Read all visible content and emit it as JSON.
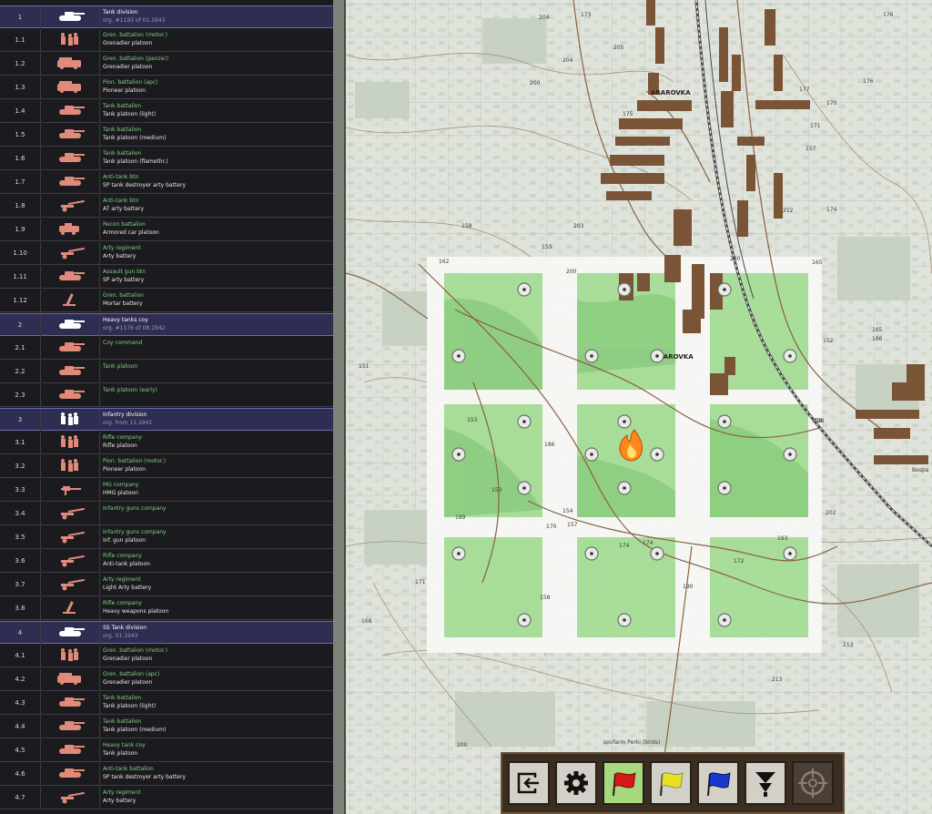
{
  "oob": {
    "rows": [
      {
        "num": "1",
        "l1": "Tank division",
        "l2": "org. #1193 of 01.1943",
        "hq": true,
        "icon": "tank-icon"
      },
      {
        "num": "1.1",
        "l1": "Gren. battalion (motor.)",
        "l2": "Grenadier platoon",
        "icon": "infantry-icon"
      },
      {
        "num": "1.2",
        "l1": "Gren. battalion (panzer)",
        "l2": "Grenadier platoon",
        "icon": "halftrack-icon"
      },
      {
        "num": "1.3",
        "l1": "Pion. battalion (apc)",
        "l2": "Pioneer platoon",
        "icon": "halftrack-icon"
      },
      {
        "num": "1.4",
        "l1": "Tank battalion",
        "l2": "Tank platoon (light)",
        "icon": "tank-icon"
      },
      {
        "num": "1.5",
        "l1": "Tank battalion",
        "l2": "Tank platoon (medium)",
        "icon": "tank-icon"
      },
      {
        "num": "1.6",
        "l1": "Tank battalion",
        "l2": "Tank platoon (flamethr.)",
        "icon": "tank-icon"
      },
      {
        "num": "1.7",
        "l1": "Anti-tank btn",
        "l2": "SP tank destroyer arty battery",
        "icon": "tank-icon"
      },
      {
        "num": "1.8",
        "l1": "Anti-tank btn",
        "l2": "AT arty battery",
        "icon": "gun-icon"
      },
      {
        "num": "1.9",
        "l1": "Recon battalion",
        "l2": "Armored car platoon",
        "icon": "armored-car-icon"
      },
      {
        "num": "1.10",
        "l1": "Arty regiment",
        "l2": "Arty battery",
        "icon": "gun-icon"
      },
      {
        "num": "1.11",
        "l1": "Assault gun btn",
        "l2": "SP arty battery",
        "icon": "tank-icon"
      },
      {
        "num": "1.12",
        "l1": "Gren. battalion",
        "l2": "Mortar battery",
        "icon": "mortar-icon"
      },
      {
        "num": "2",
        "l1": "Heavy tanks coy",
        "l2": "org. #1176 of 08.1942",
        "hq": true,
        "icon": "tank-icon"
      },
      {
        "num": "2.1",
        "l1": "Coy command",
        "l2": "",
        "icon": "tank-icon"
      },
      {
        "num": "2.2",
        "l1": "Tank platoon",
        "l2": "",
        "icon": "tank-icon"
      },
      {
        "num": "2.3",
        "l1": "Tank platoon (early)",
        "l2": "",
        "icon": "tank-icon"
      },
      {
        "num": "3",
        "l1": "Infantry division",
        "l2": "org. from 11.1941",
        "hq": true,
        "icon": "infantry-icon"
      },
      {
        "num": "3.1",
        "l1": "Rifle company",
        "l2": "Rifle platoon",
        "icon": "infantry-icon"
      },
      {
        "num": "3.2",
        "l1": "Pion. battalion (motor.)",
        "l2": "Pioneer platoon",
        "icon": "infantry-icon"
      },
      {
        "num": "3.3",
        "l1": "MG company",
        "l2": "HMG platoon",
        "icon": "mg-icon"
      },
      {
        "num": "3.4",
        "l1": "Infantry guns company",
        "l2": "",
        "icon": "gun-icon"
      },
      {
        "num": "3.5",
        "l1": "Infantry guns company",
        "l2": "Inf. gun platoon",
        "icon": "gun-icon"
      },
      {
        "num": "3.6",
        "l1": "Rifle company",
        "l2": "Anti-tank platoon",
        "icon": "gun-icon"
      },
      {
        "num": "3.7",
        "l1": "Arty regiment",
        "l2": "Light Arty battery",
        "icon": "gun-icon"
      },
      {
        "num": "3.8",
        "l1": "Rifle company",
        "l2": "Heavy weapons platoon",
        "icon": "mortar-icon"
      },
      {
        "num": "4",
        "l1": "SS Tank division",
        "l2": "org. 01.1943",
        "hq": true,
        "icon": "tank-icon"
      },
      {
        "num": "4.1",
        "l1": "Gren. battalion (motor.)",
        "l2": "Grenadier platoon",
        "icon": "infantry-icon"
      },
      {
        "num": "4.2",
        "l1": "Gren. battalion (apc)",
        "l2": "Grenadier platoon",
        "icon": "halftrack-icon"
      },
      {
        "num": "4.3",
        "l1": "Tank battalion",
        "l2": "Tank platoon (light)",
        "icon": "tank-icon"
      },
      {
        "num": "4.4",
        "l1": "Tank battalion",
        "l2": "Tank platoon (medium)",
        "icon": "tank-icon"
      },
      {
        "num": "4.5",
        "l1": "Heavy tank coy",
        "l2": "Tank platoon",
        "icon": "tank-icon"
      },
      {
        "num": "4.6",
        "l1": "Anti-tank battalion",
        "l2": "SP tank destroyer arty battery",
        "icon": "tank-icon"
      },
      {
        "num": "4.7",
        "l1": "Arty regiment",
        "l2": "Arty battery",
        "icon": "gun-icon"
      }
    ]
  },
  "map": {
    "town_labels": [
      "ARAROVKA",
      "ARAROVKA",
      "Bespa"
    ],
    "farm_label": "sovfarm Perki (birds)",
    "elevations": [
      "173",
      "176",
      "204",
      "200",
      "175",
      "170",
      "177",
      "176",
      "205",
      "171",
      "157",
      "159",
      "153",
      "203",
      "200",
      "162",
      "200",
      "212",
      "174",
      "151",
      "165",
      "166",
      "158",
      "153",
      "186",
      "153",
      "154",
      "170",
      "157",
      "189",
      "174",
      "174",
      "172",
      "190",
      "193",
      "171",
      "158",
      "200",
      "213",
      "213",
      "198",
      "202",
      "204",
      "168",
      "152",
      "165"
    ]
  },
  "toolbar": {
    "buttons": [
      {
        "name": "exit-button",
        "icon": "exit-icon"
      },
      {
        "name": "settings-button",
        "icon": "gear-icon"
      },
      {
        "name": "red-flag-button",
        "icon": "red-flag-icon",
        "active": true
      },
      {
        "name": "yellow-flag-button",
        "icon": "yellow-flag-icon"
      },
      {
        "name": "blue-flag-button",
        "icon": "blue-flag-icon"
      },
      {
        "name": "filter-button",
        "icon": "filter-icon"
      },
      {
        "name": "target-button",
        "icon": "target-icon",
        "disabled": true
      }
    ]
  },
  "colors": {
    "friendly_unit": "#e08a7a",
    "hq_unit": "#ffffff",
    "sector_green": "#9ad88a",
    "buildings": "#7a5436",
    "contour": "#a08a72"
  }
}
